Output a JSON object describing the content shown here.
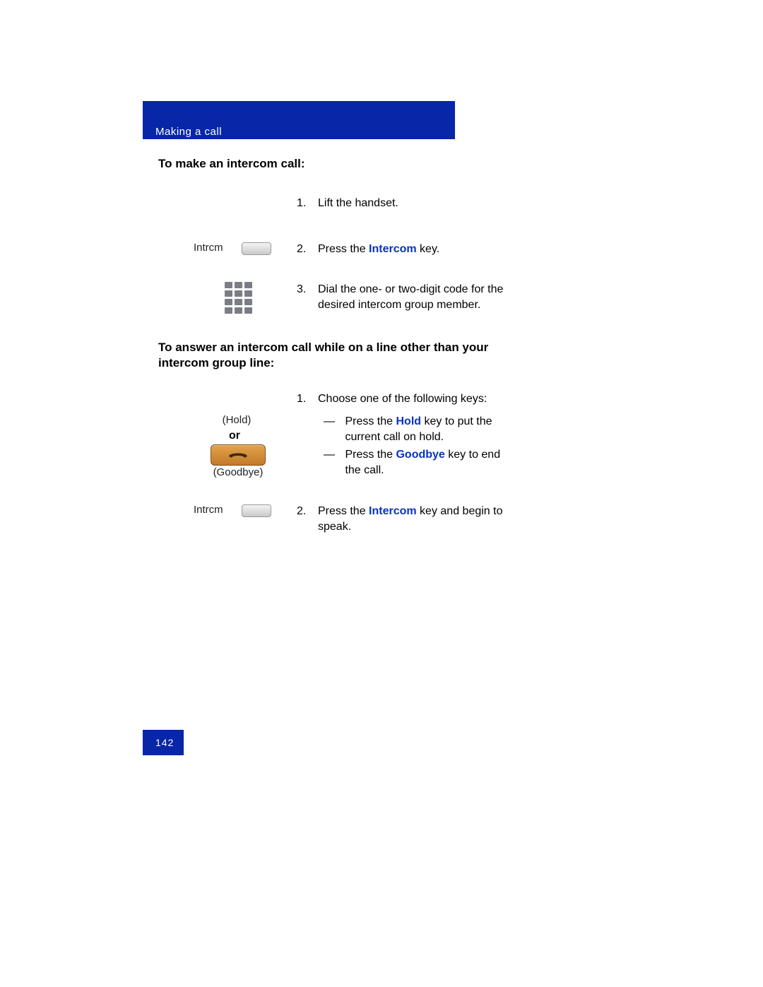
{
  "header": {
    "section": "Making a call"
  },
  "section1": {
    "title": "To make an intercom call:",
    "step1": {
      "num": "1.",
      "text": "Lift the handset."
    },
    "step2": {
      "num": "2.",
      "pre": "Press the ",
      "key": "Intercom",
      "post": " key."
    },
    "step3": {
      "num": "3.",
      "text": "Dial the one- or two-digit code for the desired intercom group member."
    },
    "key_label": "Intrcm"
  },
  "section2": {
    "title": "To answer an intercom call while on a line other than your intercom group line:",
    "step1": {
      "num": "1.",
      "text": "Choose one of the following keys:",
      "bullet1_pre": "Press the ",
      "bullet1_key": "Hold",
      "bullet1_post": " key to put the current call on hold.",
      "bullet2_pre": "Press the ",
      "bullet2_key": "Goodbye",
      "bullet2_post": " key to end the call."
    },
    "step2": {
      "num": "2.",
      "pre": "Press the ",
      "key": "Intercom",
      "post": " key and begin to speak."
    },
    "hold_label": "(Hold)",
    "or_label": "or",
    "goodbye_label": "(Goodbye)",
    "key_label": "Intrcm"
  },
  "page_number": "142"
}
